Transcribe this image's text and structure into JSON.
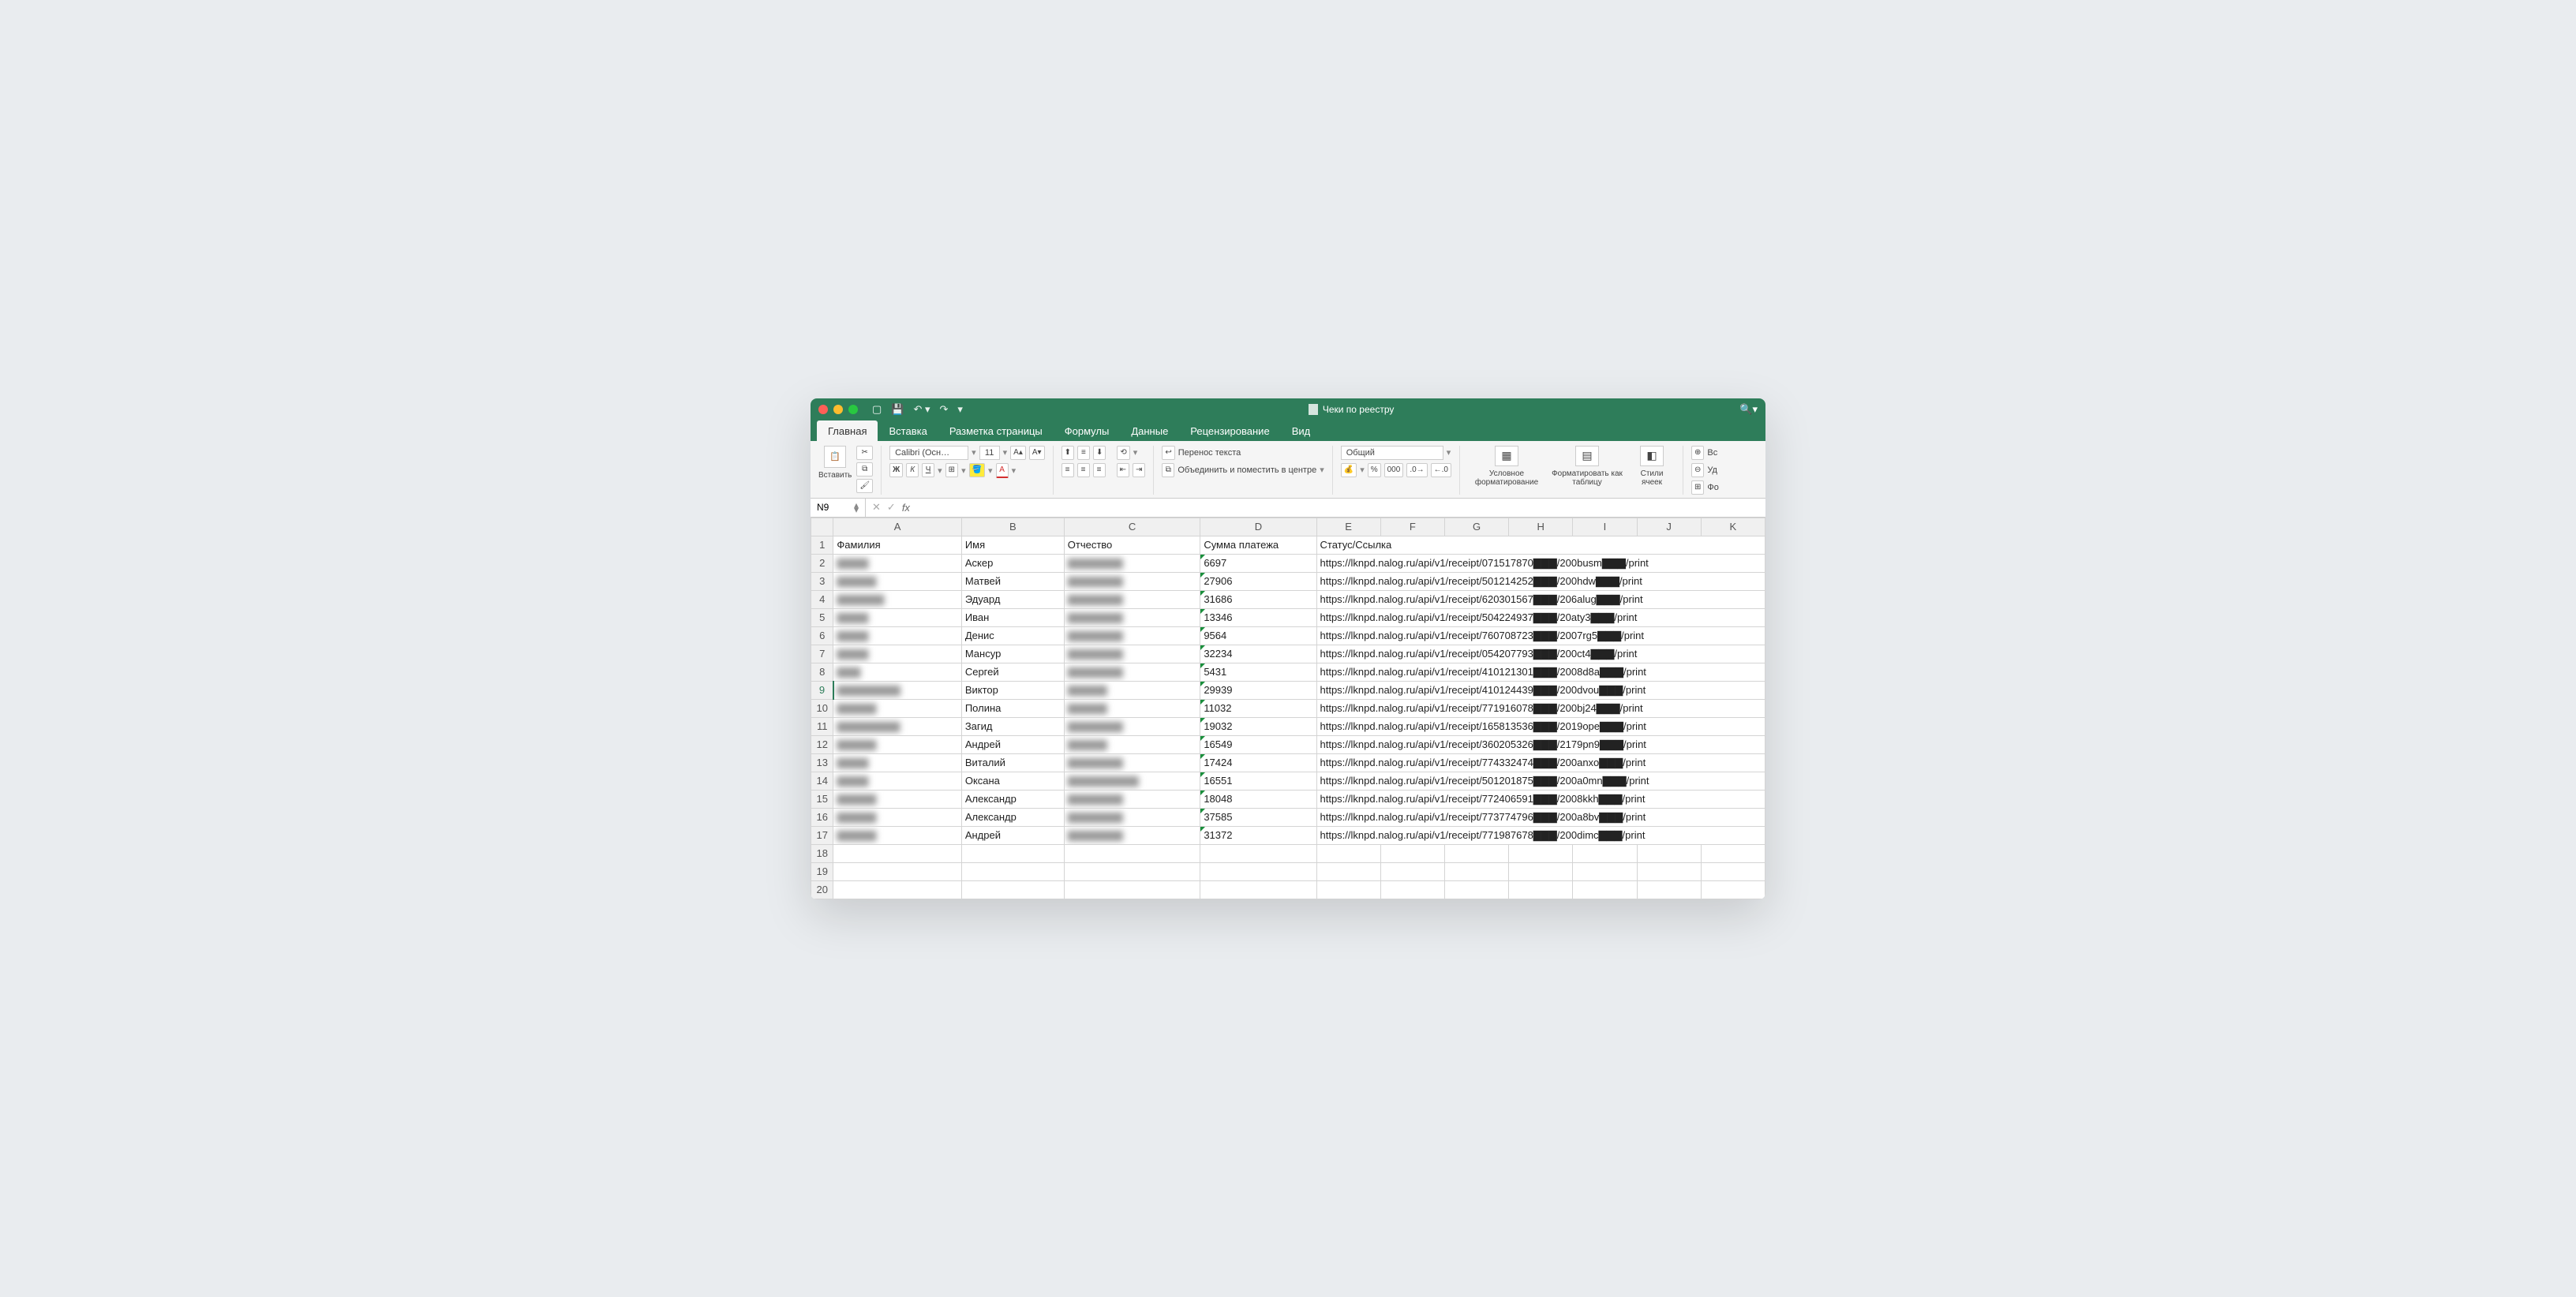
{
  "title": "Чеки по реестру",
  "cellref": "N9",
  "tabs": [
    "Главная",
    "Вставка",
    "Разметка страницы",
    "Формулы",
    "Данные",
    "Рецензирование",
    "Вид"
  ],
  "activeTab": 0,
  "ribbon": {
    "paste": "Вставить",
    "font": "Calibri (Осн…",
    "size": "11",
    "wrap": "Перенос текста",
    "merge": "Объединить и поместить в центре",
    "numfmt": "Общий",
    "condfmt": "Условное форматирование",
    "astable": "Форматировать как таблицу",
    "styles": "Стили ячеек",
    "ins": "Вс",
    "del": "Уд",
    "fmt": "Фо"
  },
  "cols": [
    "A",
    "B",
    "C",
    "D",
    "E",
    "F",
    "G",
    "H",
    "I",
    "J",
    "K"
  ],
  "headers": {
    "A": "Фамилия",
    "B": "Имя",
    "C": "Отчество",
    "D": "Сумма платежа",
    "E": "Статус/Ссылка"
  },
  "rows": [
    {
      "n": 2,
      "a": "▇▇▇▇",
      "b": "Аскер",
      "c": "▇▇▇▇▇▇▇",
      "d": "6697",
      "e": "https://lknpd.nalog.ru/api/v1/receipt/071517870▇▇▇/200busm▇▇▇/print"
    },
    {
      "n": 3,
      "a": "▇▇▇▇▇",
      "b": "Матвей",
      "c": "▇▇▇▇▇▇▇",
      "d": "27906",
      "e": "https://lknpd.nalog.ru/api/v1/receipt/501214252▇▇▇/200hdw▇▇▇/print"
    },
    {
      "n": 4,
      "a": "▇▇▇▇▇▇",
      "b": "Эдуард",
      "c": "▇▇▇▇▇▇▇",
      "d": "31686",
      "e": "https://lknpd.nalog.ru/api/v1/receipt/620301567▇▇▇/206alug▇▇▇/print"
    },
    {
      "n": 5,
      "a": "▇▇▇▇",
      "b": "Иван",
      "c": "▇▇▇▇▇▇▇",
      "d": "13346",
      "e": "https://lknpd.nalog.ru/api/v1/receipt/504224937▇▇▇/20aty3▇▇▇/print"
    },
    {
      "n": 6,
      "a": "▇▇▇▇",
      "b": "Денис",
      "c": "▇▇▇▇▇▇▇",
      "d": "9564",
      "e": "https://lknpd.nalog.ru/api/v1/receipt/760708723▇▇▇/2007rg5▇▇▇/print"
    },
    {
      "n": 7,
      "a": "▇▇▇▇",
      "b": "Мансур",
      "c": "▇▇▇▇▇▇▇",
      "d": "32234",
      "e": "https://lknpd.nalog.ru/api/v1/receipt/054207793▇▇▇/200ct4▇▇▇/print"
    },
    {
      "n": 8,
      "a": "▇▇▇",
      "b": "Сергей",
      "c": "▇▇▇▇▇▇▇",
      "d": "5431",
      "e": "https://lknpd.nalog.ru/api/v1/receipt/410121301▇▇▇/2008d8a▇▇▇/print"
    },
    {
      "n": 9,
      "a": "▇▇▇▇▇▇▇▇",
      "b": "Виктор",
      "c": "▇▇▇▇▇",
      "d": "29939",
      "e": "https://lknpd.nalog.ru/api/v1/receipt/410124439▇▇▇/200dvou▇▇▇/print"
    },
    {
      "n": 10,
      "a": "▇▇▇▇▇",
      "b": "Полина",
      "c": "▇▇▇▇▇",
      "d": "11032",
      "e": "https://lknpd.nalog.ru/api/v1/receipt/771916078▇▇▇/200bj24▇▇▇/print"
    },
    {
      "n": 11,
      "a": "▇▇▇▇▇▇▇▇",
      "b": "Загид",
      "c": "▇▇▇▇▇▇▇",
      "d": "19032",
      "e": "https://lknpd.nalog.ru/api/v1/receipt/165813536▇▇▇/2019ope▇▇▇/print"
    },
    {
      "n": 12,
      "a": "▇▇▇▇▇",
      "b": "Андрей",
      "c": "▇▇▇▇▇",
      "d": "16549",
      "e": "https://lknpd.nalog.ru/api/v1/receipt/360205326▇▇▇/2179pn9▇▇▇/print"
    },
    {
      "n": 13,
      "a": "▇▇▇▇",
      "b": "Виталий",
      "c": "▇▇▇▇▇▇▇",
      "d": "17424",
      "e": "https://lknpd.nalog.ru/api/v1/receipt/774332474▇▇▇/200anxo▇▇▇/print"
    },
    {
      "n": 14,
      "a": "▇▇▇▇",
      "b": "Оксана",
      "c": "▇▇▇▇▇▇▇▇▇",
      "d": "16551",
      "e": "https://lknpd.nalog.ru/api/v1/receipt/501201875▇▇▇/200a0mn▇▇▇/print"
    },
    {
      "n": 15,
      "a": "▇▇▇▇▇",
      "b": "Александр",
      "c": "▇▇▇▇▇▇▇",
      "d": "18048",
      "e": "https://lknpd.nalog.ru/api/v1/receipt/772406591▇▇▇/2008kkh▇▇▇/print"
    },
    {
      "n": 16,
      "a": "▇▇▇▇▇",
      "b": "Александр",
      "c": "▇▇▇▇▇▇▇",
      "d": "37585",
      "e": "https://lknpd.nalog.ru/api/v1/receipt/773774796▇▇▇/200a8bv▇▇▇/print"
    },
    {
      "n": 17,
      "a": "▇▇▇▇▇",
      "b": "Андрей",
      "c": "▇▇▇▇▇▇▇",
      "d": "31372",
      "e": "https://lknpd.nalog.ru/api/v1/receipt/771987678▇▇▇/200dimc▇▇▇/print"
    }
  ],
  "emptyRows": [
    18,
    19,
    20
  ]
}
